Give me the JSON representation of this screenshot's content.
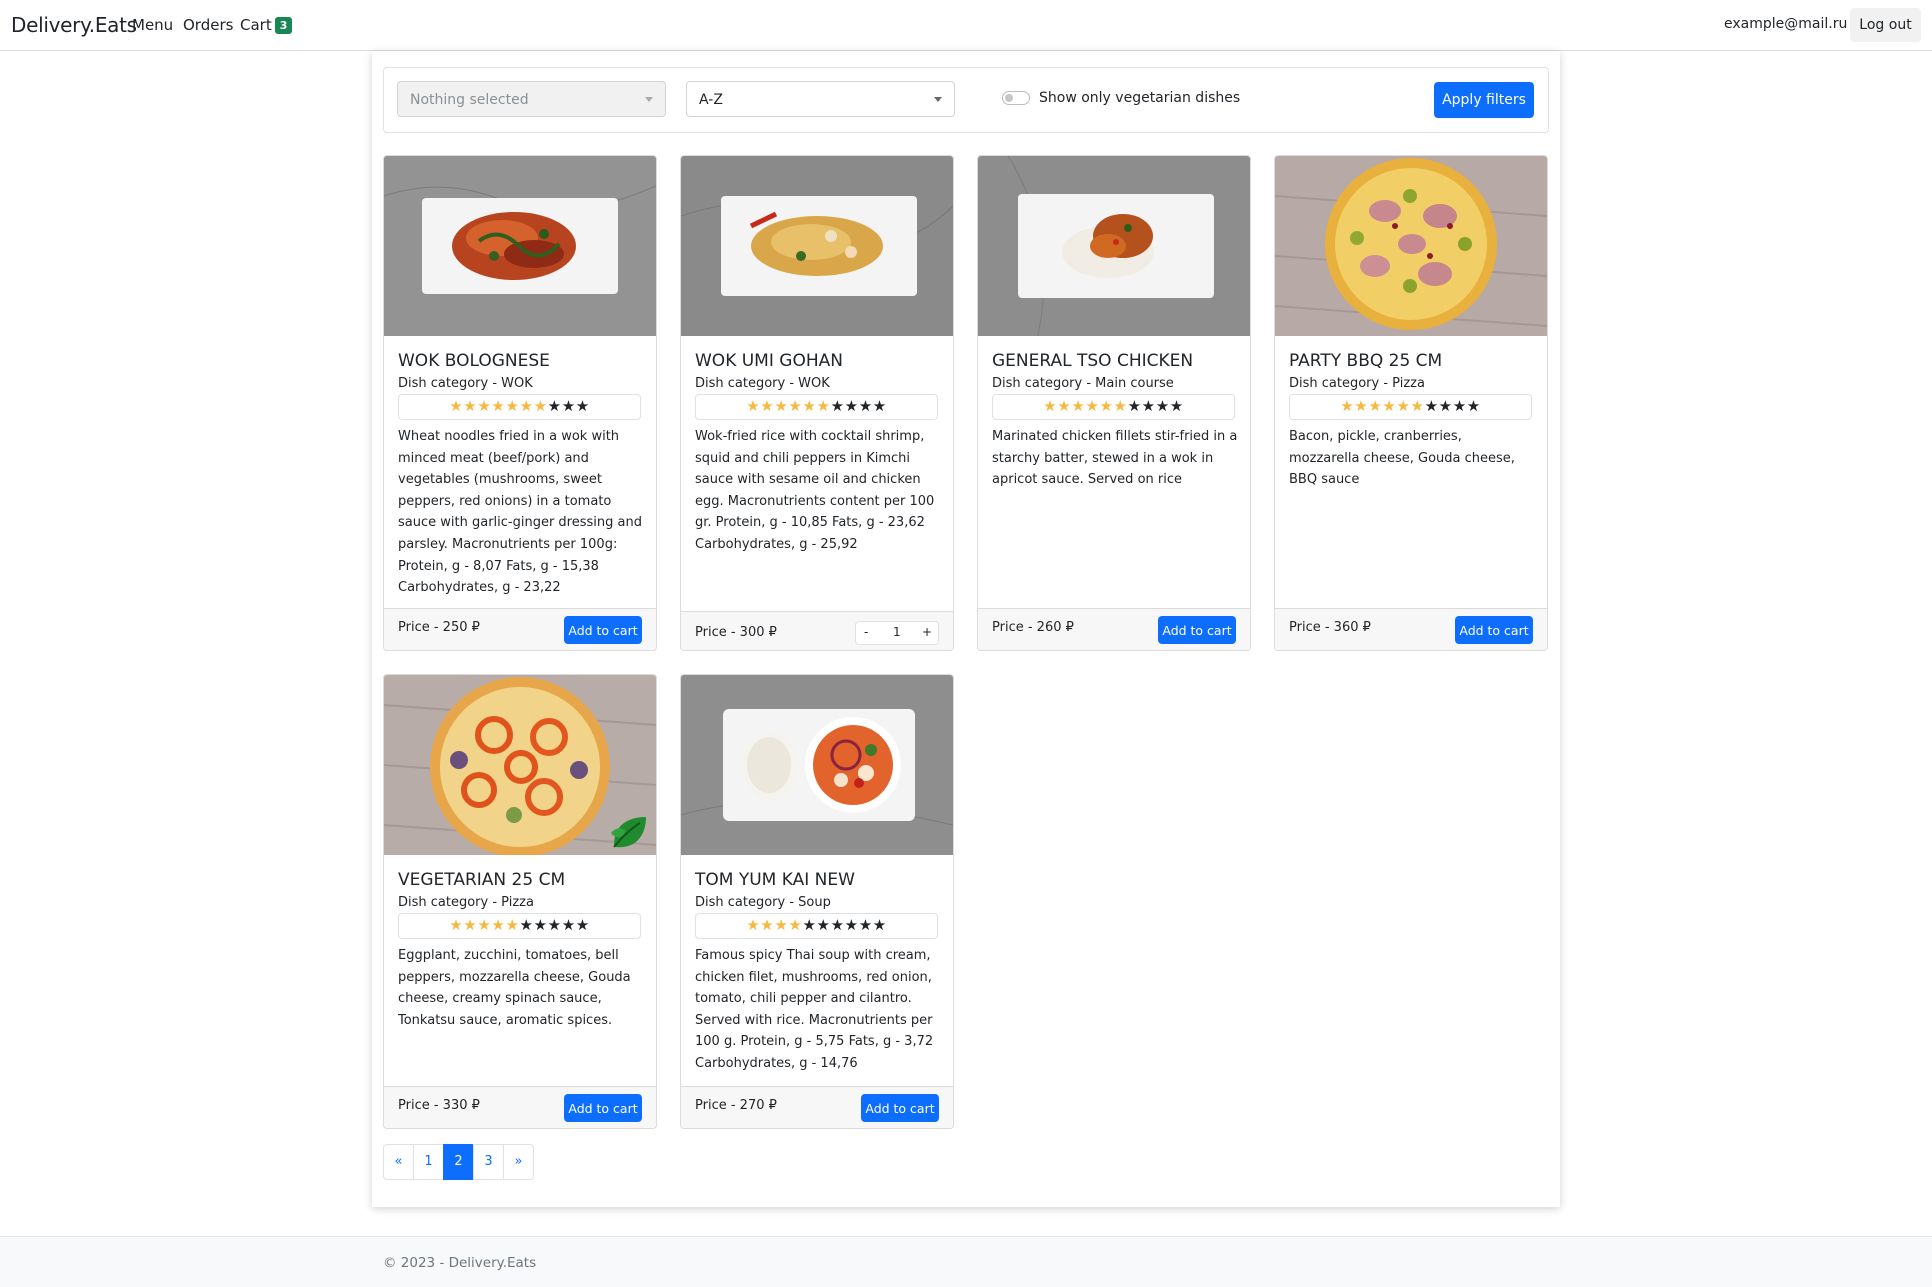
{
  "navbar": {
    "brand": "Delivery.Eats",
    "links": [
      {
        "label": "Menu"
      },
      {
        "label": "Orders"
      },
      {
        "label": "Cart"
      }
    ],
    "cart_count": "3",
    "user_email": "example@mail.ru",
    "logout_label": "Log out"
  },
  "filters": {
    "category_value": "Nothing selected",
    "sort_value": "A-Z",
    "vegetarian_label": "Show only vegetarian dishes",
    "vegetarian_on": false,
    "apply_label": "Apply filters"
  },
  "dishes": [
    {
      "name": "WOK BOLOGNESE",
      "category": "Dish category - WOK",
      "rating": 6.5,
      "rating_max": 10,
      "description": "Wheat noodles fried in a wok with minced meat (beef/pork) and vegetables (mushrooms, sweet peppers, red onions) in a tomato sauce with garlic-ginger dressing and parsley. Macronutrients per 100g: Protein, g - 8,07 Fats, g - 15,38 Carbohydrates, g - 23,22",
      "price": "Price - 250 ₽",
      "action": "Add to cart"
    },
    {
      "name": "WOK UMI GOHAN",
      "category": "Dish category - WOK",
      "rating": 6,
      "rating_max": 10,
      "description": "Wok-fried rice with cocktail shrimp, squid and chili peppers in Kimchi sauce with sesame oil and chicken egg. Macronutrients content per 100 gr. Protein, g - 10,85 Fats, g - 23,62 Carbohydrates, g - 25,92",
      "price": "Price - 300 ₽",
      "quantity": "1",
      "minus": "-",
      "plus": "+"
    },
    {
      "name": "GENERAL TSO CHICKEN",
      "category": "Dish category - Main course",
      "rating": 6,
      "rating_max": 10,
      "description": "Marinated chicken fillets stir-fried in a starchy batter, stewed in a wok in apricot sauce. Served on rice",
      "price": "Price - 260 ₽",
      "action": "Add to cart"
    },
    {
      "name": "PARTY BBQ 25 CM",
      "category": "Dish category - Pizza",
      "rating": 5.5,
      "rating_max": 10,
      "description": "Bacon, pickle, cranberries, mozzarella cheese, Gouda cheese, BBQ sauce",
      "price": "Price - 360 ₽",
      "action": "Add to cart"
    },
    {
      "name": "VEGETARIAN 25 CM",
      "category": "Dish category - Pizza",
      "rating": 5,
      "rating_max": 10,
      "description": "Eggplant, zucchini, tomatoes, bell peppers, mozzarella cheese, Gouda cheese, creamy spinach sauce, Tonkatsu sauce, aromatic spices.",
      "price": "Price - 330 ₽",
      "action": "Add to cart",
      "vegetarian": true
    },
    {
      "name": "TOM YUM KAI NEW",
      "category": "Dish category - Soup",
      "rating": 4,
      "rating_max": 10,
      "description": "Famous spicy Thai soup with cream, chicken filet, mushrooms, red onion, tomato, chili pepper and cilantro. Served with rice. Macronutrients per 100 g. Protein, g - 5,75 Fats, g - 3,72 Carbohydrates, g - 14,76",
      "price": "Price - 270 ₽",
      "action": "Add to cart"
    }
  ],
  "pagination": {
    "prev": "«",
    "pages": [
      "1",
      "2",
      "3"
    ],
    "current": "2",
    "next": "»"
  },
  "footer": {
    "text": "© 2023 - Delivery.Eats"
  },
  "colors": {
    "primary": "#0d6efd",
    "cart_badge": "#198754",
    "star_on": "#f5b942",
    "star_off": "#212529",
    "vegetarian_leaf": "#1f8a2e"
  }
}
